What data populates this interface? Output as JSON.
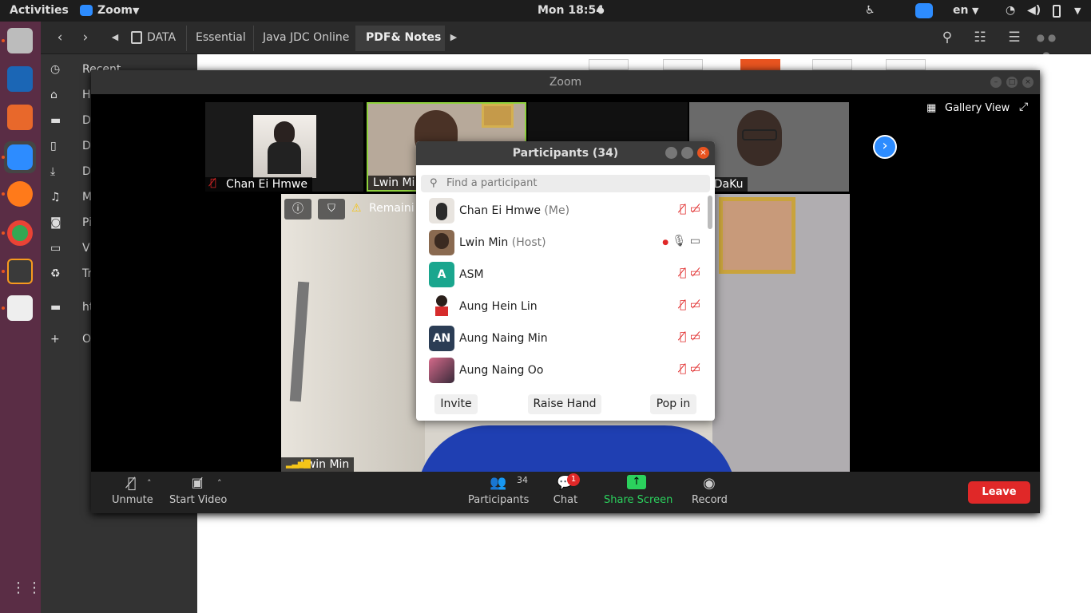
{
  "topbar": {
    "activities": "Activities",
    "app_menu": "Zoom",
    "clock": "Mon 18:54",
    "lang": "en"
  },
  "dock": {
    "apps": [
      "files-icon",
      "writer-icon",
      "software-icon",
      "zoom-icon",
      "firefox-icon",
      "chrome-icon",
      "sublime-icon",
      "evince-icon"
    ]
  },
  "filemanager": {
    "breadcrumbs": [
      "DATA",
      "Essential",
      "Java JDC Online",
      "PDF& Notes"
    ],
    "sidebar": [
      "Recent",
      "H",
      "D",
      "D",
      "D",
      "M",
      "Pi",
      "V",
      "Tr",
      "ht",
      "O"
    ]
  },
  "zoom": {
    "title": "Zoom",
    "view_label": "Gallery View",
    "tiles": [
      {
        "name": "Chan Ei Hmwe"
      },
      {
        "name": "Lwin Mi"
      },
      {
        "name": "sanDaKu"
      }
    ],
    "speaker": {
      "name": "Lwin Min",
      "banner": "Remaini"
    },
    "controls": {
      "unmute": "Unmute",
      "start_video": "Start Video",
      "participants": "Participants",
      "participant_count": "34",
      "chat": "Chat",
      "chat_badge": "1",
      "share": "Share Screen",
      "record": "Record",
      "leave": "Leave"
    }
  },
  "participants_panel": {
    "title": "Participants (34)",
    "search_placeholder": "Find a participant",
    "rows": [
      {
        "name": "Chan Ei Hmwe",
        "role": "(Me)",
        "avatar": "photo"
      },
      {
        "name": "Lwin Min",
        "role": "(Host)",
        "avatar": "photo"
      },
      {
        "name": "ASM",
        "role": "",
        "avatar": "A"
      },
      {
        "name": "Aung Hein Lin",
        "role": "",
        "avatar": "cartoon"
      },
      {
        "name": "Aung Naing Min",
        "role": "",
        "avatar": "AN"
      },
      {
        "name": "Aung Naing Oo",
        "role": "",
        "avatar": "photo"
      }
    ],
    "buttons": {
      "invite": "Invite",
      "raise_hand": "Raise Hand",
      "pop_in": "Pop in"
    }
  },
  "colors": {
    "accent": "#2d8cff",
    "leave": "#e02828",
    "share": "#2bd15d",
    "dock": "#5a2d45"
  }
}
